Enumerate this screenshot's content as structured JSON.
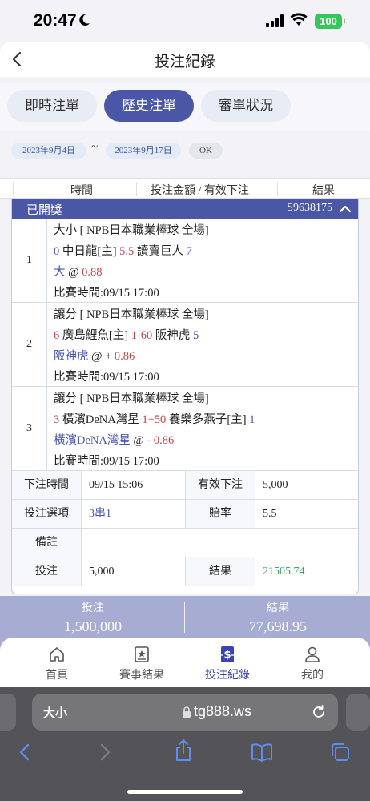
{
  "status_bar": {
    "time": "20:47",
    "battery": "100"
  },
  "header": {
    "title": "投注紀錄"
  },
  "tabs": [
    {
      "label": "即時注單",
      "active": false
    },
    {
      "label": "歷史注單",
      "active": true
    },
    {
      "label": "審單狀況",
      "active": false
    }
  ],
  "date_range": {
    "start": "2023年9月4日",
    "separator": "~",
    "end": "2023年9月17日",
    "ok_label": "OK"
  },
  "columns": [
    "時間",
    "投注金額 / 有效下注",
    "結果"
  ],
  "record": {
    "status": "已開獎",
    "id": "S9638175",
    "legs": [
      {
        "index": "1",
        "market": "大小 [ NPB日本職業棒球 全場]",
        "home_score": "0",
        "home_team": "中日龍[主]",
        "line": "5.5",
        "away_team": "讀賣巨人",
        "away_score": "7",
        "pick": "大",
        "at": "@",
        "odds": "0.88",
        "match_time": "比賽時間:09/15 17:00"
      },
      {
        "index": "2",
        "market": "讓分 [ NPB日本職業棒球 全場]",
        "home_score": "6",
        "home_team": "廣島鯉魚[主]",
        "line": "1-60",
        "away_team": "阪神虎",
        "away_score": "5",
        "pick": "阪神虎",
        "at": "@ +",
        "odds": "0.86",
        "match_time": "比賽時間:09/15 17:00"
      },
      {
        "index": "3",
        "market": "讓分 [ NPB日本職業棒球 全場]",
        "home_score": "3",
        "home_team": "橫濱DeNA灣星",
        "line": "1+50",
        "away_team": "養樂多燕子[主]",
        "away_score": "1",
        "pick": "橫濱DeNA灣星",
        "at": "@ -",
        "odds": "0.86",
        "match_time": "比賽時間:09/15 17:00"
      }
    ],
    "details": {
      "bet_time_label": "下注時間",
      "bet_time": "09/15 15:06",
      "valid_bet_label": "有效下注",
      "valid_bet": "5,000",
      "option_label": "投注選項",
      "option": "3串1",
      "odds_label": "賠率",
      "odds": "5.5",
      "note_label": "備註",
      "note": "",
      "stake_label": "投注",
      "stake": "5,000",
      "result_label": "結果",
      "result": "21505.74"
    }
  },
  "summary": {
    "stake_label": "投注",
    "stake": "1,500,000",
    "result_label": "結果",
    "result": "77,698.95"
  },
  "bottom_nav": [
    {
      "label": "首頁",
      "icon": "home-icon"
    },
    {
      "label": "賽事結果",
      "icon": "star-doc-icon"
    },
    {
      "label": "投注紀錄",
      "icon": "dollar-doc-icon",
      "active": true
    },
    {
      "label": "我的",
      "icon": "user-icon"
    }
  ],
  "browser": {
    "text_size_label": "大小",
    "url": "tg888.ws"
  },
  "colors": {
    "primary": "#4a56a6",
    "red": "#c8434c",
    "blue": "#4a56b8",
    "green": "#3aa361"
  }
}
